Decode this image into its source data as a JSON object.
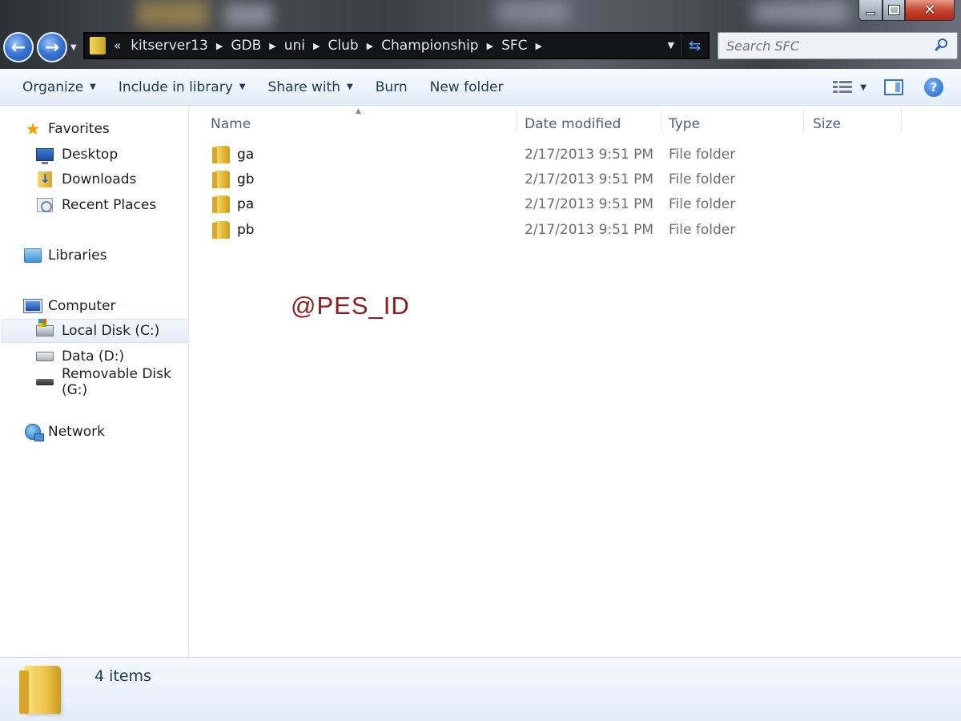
{
  "window": {
    "controls": {
      "minimize_icon": "minimize-icon",
      "maximize_icon": "restore-icon",
      "close_icon": "close-icon",
      "close_color": "#c4412b"
    }
  },
  "navigation": {
    "back_icon": "back-arrow-icon",
    "forward_icon": "forward-arrow-icon",
    "address_overflow": "«",
    "breadcrumbs": [
      "kitserver13",
      "GDB",
      "uni",
      "Club",
      "Championship",
      "SFC"
    ],
    "refresh_icon": "refresh-icon"
  },
  "search": {
    "placeholder": "Search SFC",
    "icon": "search-icon"
  },
  "toolbar": {
    "organize": "Organize",
    "include_in_library": "Include in library",
    "share_with": "Share with",
    "burn": "Burn",
    "new_folder": "New folder",
    "views_icon": "views-icon",
    "preview_icon": "preview-pane-icon",
    "help_icon": "help-icon",
    "accent_color": "#1e395b"
  },
  "sidebar": {
    "favorites": {
      "label": "Favorites",
      "icon": "star-icon",
      "items": [
        {
          "label": "Desktop",
          "icon": "desktop-icon"
        },
        {
          "label": "Downloads",
          "icon": "downloads-icon"
        },
        {
          "label": "Recent Places",
          "icon": "recent-places-icon"
        }
      ]
    },
    "libraries": {
      "label": "Libraries",
      "icon": "libraries-icon"
    },
    "computer": {
      "label": "Computer",
      "icon": "computer-icon",
      "items": [
        {
          "label": "Local Disk (C:)",
          "icon": "local-disk-icon",
          "selected": true
        },
        {
          "label": "Data (D:)",
          "icon": "drive-icon"
        },
        {
          "label": "Removable Disk (G:)",
          "icon": "removable-disk-icon"
        }
      ]
    },
    "network": {
      "label": "Network",
      "icon": "network-icon"
    }
  },
  "filelist": {
    "columns": [
      "Name",
      "Date modified",
      "Type",
      "Size"
    ],
    "sorted_by": "Name",
    "rows": [
      {
        "name": "ga",
        "date": "2/17/2013 9:51 PM",
        "type": "File folder",
        "size": ""
      },
      {
        "name": "gb",
        "date": "2/17/2013 9:51 PM",
        "type": "File folder",
        "size": ""
      },
      {
        "name": "pa",
        "date": "2/17/2013 9:51 PM",
        "type": "File folder",
        "size": ""
      },
      {
        "name": "pb",
        "date": "2/17/2013 9:51 PM",
        "type": "File folder",
        "size": ""
      }
    ]
  },
  "watermark": {
    "text": "@PES_ID",
    "color": "#8b1c1c"
  },
  "details": {
    "item_count": "4 items",
    "icon": "folder-icon"
  }
}
